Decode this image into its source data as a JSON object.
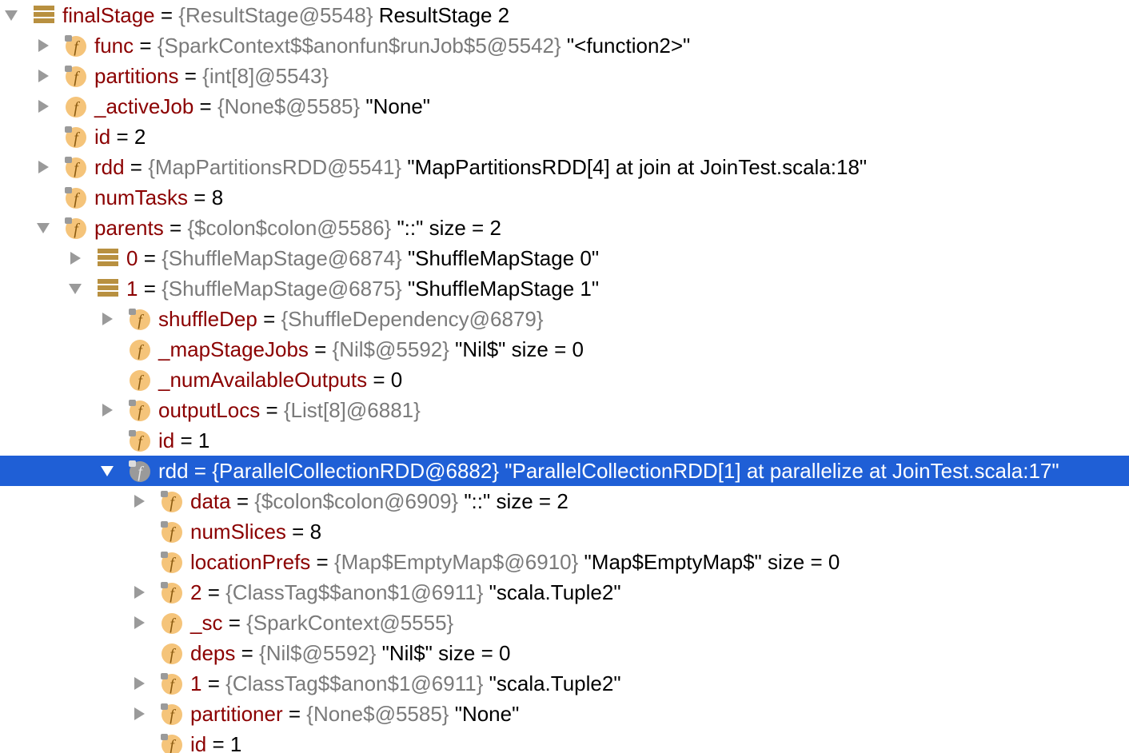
{
  "colors": {
    "name": "#8b0000",
    "type": "#7a7a7a",
    "selection": "#1f5fd6",
    "field_icon": "#f5c47a",
    "array_icon": "#b89040",
    "toggle": "#9a9a9a"
  },
  "rows": [
    {
      "depth": 0,
      "toggle": "expanded",
      "icon": "array-icon",
      "name": "finalStage",
      "type": "{ResultStage@5548}",
      "value": "ResultStage 2"
    },
    {
      "depth": 1,
      "toggle": "collapsed",
      "icon": "field-icon",
      "name": "func",
      "type": "{SparkContext$$anonfun$runJob$5@5542}",
      "value": "\"<function2>\""
    },
    {
      "depth": 1,
      "toggle": "collapsed",
      "icon": "field-icon",
      "name": "partitions",
      "type": "{int[8]@5543}",
      "value": ""
    },
    {
      "depth": 1,
      "toggle": "collapsed",
      "icon": "field-icon-plain",
      "name": "_activeJob",
      "type": "{None$@5585}",
      "value": "\"None\""
    },
    {
      "depth": 1,
      "toggle": "none",
      "icon": "field-icon",
      "name": "id",
      "type": "",
      "value": "2"
    },
    {
      "depth": 1,
      "toggle": "collapsed",
      "icon": "field-icon",
      "name": "rdd",
      "type": "{MapPartitionsRDD@5541}",
      "value": "\"MapPartitionsRDD[4] at join at JoinTest.scala:18\""
    },
    {
      "depth": 1,
      "toggle": "none",
      "icon": "field-icon",
      "name": "numTasks",
      "type": "",
      "value": "8"
    },
    {
      "depth": 1,
      "toggle": "expanded",
      "icon": "field-icon",
      "name": "parents",
      "type": "{$colon$colon@5586}",
      "value": "\"::\" size = 2"
    },
    {
      "depth": 2,
      "toggle": "collapsed",
      "icon": "array-icon",
      "name": "0",
      "type": "{ShuffleMapStage@6874}",
      "value": "\"ShuffleMapStage 0\""
    },
    {
      "depth": 2,
      "toggle": "expanded",
      "icon": "array-icon",
      "name": "1",
      "type": "{ShuffleMapStage@6875}",
      "value": "\"ShuffleMapStage 1\""
    },
    {
      "depth": 3,
      "toggle": "collapsed",
      "icon": "field-icon",
      "name": "shuffleDep",
      "type": "{ShuffleDependency@6879}",
      "value": ""
    },
    {
      "depth": 3,
      "toggle": "none",
      "icon": "field-icon-plain",
      "name": "_mapStageJobs",
      "type": "{Nil$@5592}",
      "value": "\"Nil$\" size = 0"
    },
    {
      "depth": 3,
      "toggle": "none",
      "icon": "field-icon-plain",
      "name": "_numAvailableOutputs",
      "type": "",
      "value": "0"
    },
    {
      "depth": 3,
      "toggle": "collapsed",
      "icon": "field-icon",
      "name": "outputLocs",
      "type": "{List[8]@6881}",
      "value": ""
    },
    {
      "depth": 3,
      "toggle": "none",
      "icon": "field-icon",
      "name": "id",
      "type": "",
      "value": "1"
    },
    {
      "depth": 3,
      "toggle": "expanded",
      "icon": "field-icon-selected",
      "name": "rdd",
      "type": "{ParallelCollectionRDD@6882}",
      "value": "\"ParallelCollectionRDD[1] at parallelize at JoinTest.scala:17\"",
      "selected": true
    },
    {
      "depth": 4,
      "toggle": "collapsed",
      "icon": "field-icon",
      "name": "data",
      "type": "{$colon$colon@6909}",
      "value": "\"::\" size = 2"
    },
    {
      "depth": 4,
      "toggle": "none",
      "icon": "field-icon",
      "name": "numSlices",
      "type": "",
      "value": "8"
    },
    {
      "depth": 4,
      "toggle": "none",
      "icon": "field-icon",
      "name": "locationPrefs",
      "type": "{Map$EmptyMap$@6910}",
      "value": "\"Map$EmptyMap$\" size = 0"
    },
    {
      "depth": 4,
      "toggle": "collapsed",
      "icon": "field-icon",
      "name": "2",
      "type": "{ClassTag$$anon$1@6911}",
      "value": "\"scala.Tuple2\""
    },
    {
      "depth": 4,
      "toggle": "collapsed",
      "icon": "field-icon-plain",
      "name": "_sc",
      "type": "{SparkContext@5555}",
      "value": ""
    },
    {
      "depth": 4,
      "toggle": "none",
      "icon": "field-icon-plain",
      "name": "deps",
      "type": "{Nil$@5592}",
      "value": "\"Nil$\" size = 0"
    },
    {
      "depth": 4,
      "toggle": "collapsed",
      "icon": "field-icon",
      "name": "1",
      "type": "{ClassTag$$anon$1@6911}",
      "value": "\"scala.Tuple2\""
    },
    {
      "depth": 4,
      "toggle": "collapsed",
      "icon": "field-icon",
      "name": "partitioner",
      "type": "{None$@5585}",
      "value": "\"None\""
    },
    {
      "depth": 4,
      "toggle": "none",
      "icon": "field-icon",
      "name": "id",
      "type": "",
      "value": "1"
    }
  ]
}
